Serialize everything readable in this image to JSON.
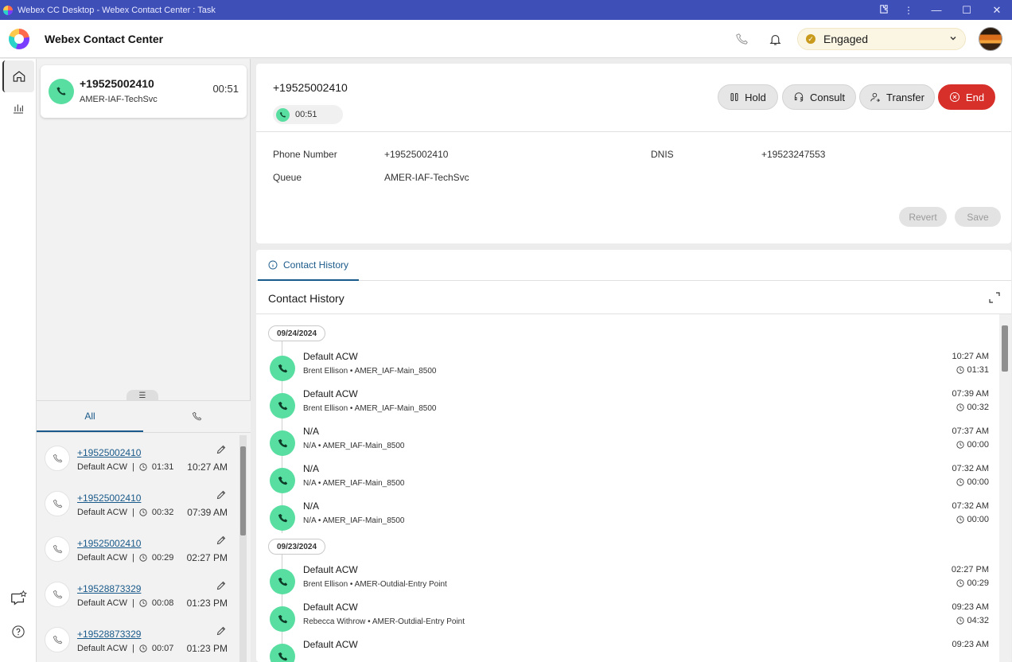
{
  "window": {
    "title": "Webex CC Desktop - Webex Contact Center : Task"
  },
  "header": {
    "brand": "Webex Contact Center",
    "agent_state": "Engaged",
    "colors": {
      "state_bg": "#fbf5e3",
      "state_dot": "#c99a1b"
    }
  },
  "rail": {
    "items": [
      "home-icon",
      "analytics-icon",
      "feedback-icon",
      "help-icon"
    ]
  },
  "task": {
    "number": "+19525002410",
    "queue": "AMER-IAF-TechSvc",
    "elapsed": "00:51"
  },
  "recent": {
    "tabs": [
      "All",
      "phone-icon"
    ],
    "items": [
      {
        "number": "+19525002410",
        "status": "Default ACW",
        "duration": "01:31",
        "time": "10:27 AM"
      },
      {
        "number": "+19525002410",
        "status": "Default ACW",
        "duration": "00:32",
        "time": "07:39 AM"
      },
      {
        "number": "+19525002410",
        "status": "Default ACW",
        "duration": "00:29",
        "time": "02:27 PM"
      },
      {
        "number": "+19528873329",
        "status": "Default ACW",
        "duration": "00:08",
        "time": "01:23 PM"
      },
      {
        "number": "+19528873329",
        "status": "Default ACW",
        "duration": "00:07",
        "time": "01:23 PM"
      }
    ]
  },
  "interaction": {
    "ani": "+19525002410",
    "timer": "00:51",
    "controls": {
      "hold": "Hold",
      "consult": "Consult",
      "transfer": "Transfer",
      "end": "End"
    },
    "fields": {
      "phone_label": "Phone Number",
      "phone_value": "+19525002410",
      "dnis_label": "DNIS",
      "dnis_value": "+19523247553",
      "queue_label": "Queue",
      "queue_value": "AMER-IAF-TechSvc"
    },
    "revert": "Revert",
    "save": "Save",
    "colors": {
      "end": "#d7302a",
      "call": "#57dea0"
    }
  },
  "history": {
    "tab_label": "Contact History",
    "title": "Contact History",
    "groups": [
      {
        "date": "09/24/2024",
        "items": [
          {
            "title": "Default ACW",
            "sub": "Brent Ellison • AMER_IAF-Main_8500",
            "time": "10:27 AM",
            "duration": "01:31"
          },
          {
            "title": "Default ACW",
            "sub": "Brent Ellison • AMER_IAF-Main_8500",
            "time": "07:39 AM",
            "duration": "00:32"
          },
          {
            "title": "N/A",
            "sub": "N/A • AMER_IAF-Main_8500",
            "time": "07:37 AM",
            "duration": "00:00"
          },
          {
            "title": "N/A",
            "sub": "N/A • AMER_IAF-Main_8500",
            "time": "07:32 AM",
            "duration": "00:00"
          },
          {
            "title": "N/A",
            "sub": "N/A • AMER_IAF-Main_8500",
            "time": "07:32 AM",
            "duration": "00:00"
          }
        ]
      },
      {
        "date": "09/23/2024",
        "items": [
          {
            "title": "Default ACW",
            "sub": "Brent Ellison • AMER-Outdial-Entry Point",
            "time": "02:27 PM",
            "duration": "00:29"
          },
          {
            "title": "Default ACW",
            "sub": "Rebecca Withrow • AMER-Outdial-Entry Point",
            "time": "09:23 AM",
            "duration": "04:32"
          },
          {
            "title": "Default ACW",
            "sub": "",
            "time": "09:23 AM",
            "duration": ""
          }
        ]
      }
    ]
  }
}
